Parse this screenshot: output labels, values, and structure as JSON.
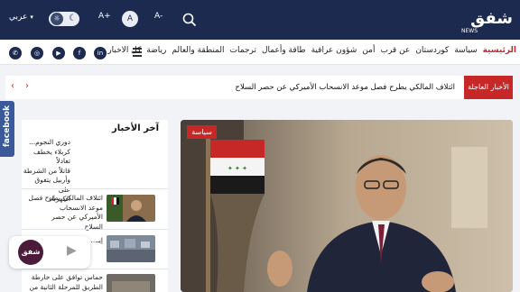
{
  "header": {
    "language_label": "عربي",
    "font_decrease": "A-",
    "font_default": "A",
    "font_increase": "A+",
    "logo_text": "شفق",
    "logo_sub": "NEWS"
  },
  "nav": {
    "items": [
      "الرئيسية",
      "سياسة",
      "كوردستان",
      "عن قرب",
      "أمن",
      "شؤون عراقية",
      "طاقة وأعمال",
      "ترجمات",
      "المنطقة والعالم",
      "رياضة",
      "كل الاخبار"
    ],
    "social": [
      "in",
      "f",
      "▶",
      "◎",
      "✆"
    ]
  },
  "breaking": {
    "label": "الأخبار العاجلة",
    "headline": "ائتلاف المالكي يطرح فصل موعد الانسحاب الأميركي عن حصر السلاح"
  },
  "sidebar_tab": "facebook",
  "latest": {
    "title": "آخر الأخبار",
    "items": [
      "دوري النجوم...\nكربلاء يخطف تعادلاً\nقاتلاً من الشرطة\nوأربيل يتفوق على\nالكهرباء",
      "ائتلاف المالكي يطرح فصل\nموعد الانسحاب\nالأميركي عن حصر\nالسلاح",
      "إيـ...",
      "حماس توافق على خارطة\nالطريق للمرحلة الثانية من"
    ]
  },
  "hero": {
    "category": "سياسة"
  },
  "player": {
    "logo_text": "شفق"
  },
  "colors": {
    "navy": "#1b2a4e",
    "accent_red": "#c62828",
    "facebook": "#3b5998"
  }
}
